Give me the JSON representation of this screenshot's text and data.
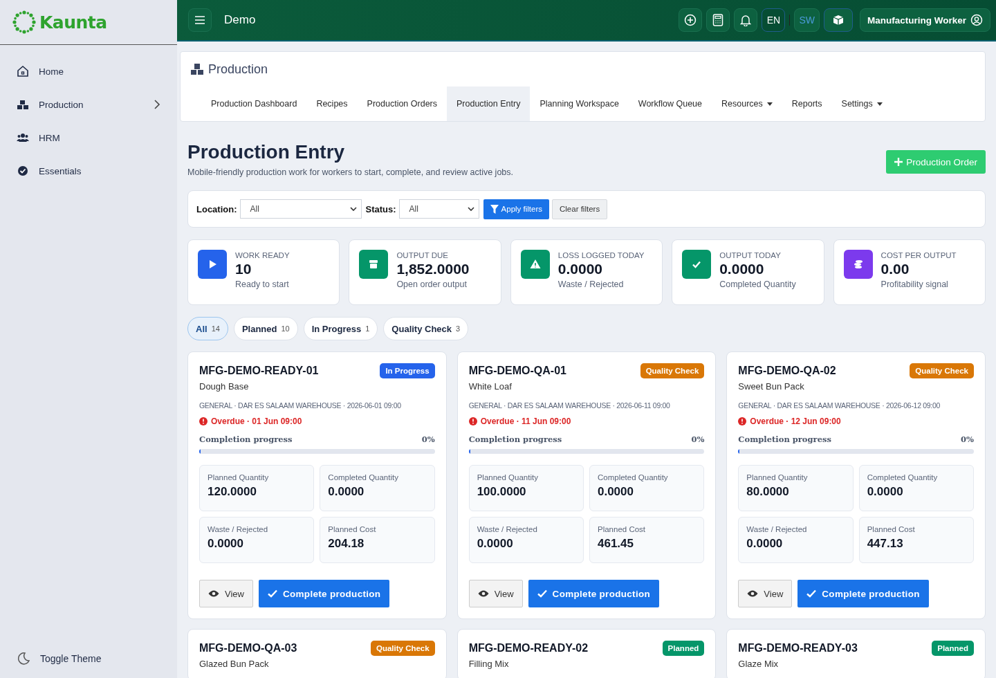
{
  "brand": {
    "name": "Kaunta"
  },
  "sidebar": {
    "items": [
      {
        "label": "Home",
        "expandable": false
      },
      {
        "label": "Production",
        "expandable": true
      },
      {
        "label": "HRM",
        "expandable": false
      },
      {
        "label": "Essentials",
        "expandable": false
      }
    ],
    "footer": {
      "label": "Toggle Theme"
    }
  },
  "topbar": {
    "title": "Demo",
    "languages": [
      {
        "label": "EN",
        "selected": true
      },
      {
        "label": "SW",
        "selected": false
      }
    ],
    "user": "Manufacturing Worker"
  },
  "module": {
    "title": "Production",
    "tabs": [
      {
        "label": "Production Dashboard",
        "selected": false,
        "dropdown": false
      },
      {
        "label": "Recipes",
        "selected": false,
        "dropdown": false
      },
      {
        "label": "Production Orders",
        "selected": false,
        "dropdown": false
      },
      {
        "label": "Production Entry",
        "selected": true,
        "dropdown": false
      },
      {
        "label": "Planning Workspace",
        "selected": false,
        "dropdown": false
      },
      {
        "label": "Workflow Queue",
        "selected": false,
        "dropdown": false
      },
      {
        "label": "Resources",
        "selected": false,
        "dropdown": true
      },
      {
        "label": "Reports",
        "selected": false,
        "dropdown": false
      },
      {
        "label": "Settings",
        "selected": false,
        "dropdown": true
      }
    ]
  },
  "page": {
    "title": "Production Entry",
    "subtitle": "Mobile-friendly production work for workers to start, complete, and review active jobs.",
    "action": "Production Order"
  },
  "filters": {
    "location": {
      "label": "Location:",
      "value": "All"
    },
    "status": {
      "label": "Status:",
      "value": "All"
    },
    "apply": "Apply filters",
    "clear": "Clear filters"
  },
  "metrics": [
    {
      "label": "WORK READY",
      "value": "10",
      "note": "Ready to start",
      "color": "#2563eb"
    },
    {
      "label": "OUTPUT DUE",
      "value": "1,852.0000",
      "note": "Open order output",
      "color": "#059669"
    },
    {
      "label": "LOSS LOGGED TODAY",
      "value": "0.0000",
      "note": "Waste / Rejected",
      "color": "#059669"
    },
    {
      "label": "OUTPUT TODAY",
      "value": "0.0000",
      "note": "Completed Quantity",
      "color": "#059669"
    },
    {
      "label": "COST PER OUTPUT",
      "value": "0.00",
      "note": "Profitability signal",
      "color": "#7c3aed"
    }
  ],
  "status_filters": [
    {
      "label": "All",
      "count": "14",
      "selected": true
    },
    {
      "label": "Planned",
      "count": "10",
      "selected": false
    },
    {
      "label": "In Progress",
      "count": "1",
      "selected": false
    },
    {
      "label": "Quality Check",
      "count": "3",
      "selected": false
    }
  ],
  "orders": [
    {
      "code": "MFG-DEMO-READY-01",
      "status": "In Progress",
      "kind": "in_progress",
      "product": "Dough Base",
      "meta": "GENERAL · DAR ES SALAAM WAREHOUSE · 2026-06-01 09:00",
      "overdue": "Overdue · 01 Jun 09:00",
      "progress_label": "Completion progress",
      "progress_text": "0%",
      "level": 0,
      "stats": [
        {
          "label": "Planned Quantity",
          "value": "120.0000"
        },
        {
          "label": "Completed Quantity",
          "value": "0.0000"
        },
        {
          "label": "Waste / Rejected",
          "value": "0.0000"
        },
        {
          "label": "Planned Cost",
          "value": "204.18"
        }
      ],
      "view": "View",
      "complete": "Complete production"
    },
    {
      "code": "MFG-DEMO-QA-01",
      "status": "Quality Check",
      "kind": "quality_check",
      "product": "White Loaf",
      "meta": "GENERAL · DAR ES SALAAM WAREHOUSE · 2026-06-11 09:00",
      "overdue": "Overdue · 11 Jun 09:00",
      "progress_label": "Completion progress",
      "progress_text": "0%",
      "level": 0,
      "stats": [
        {
          "label": "Planned Quantity",
          "value": "100.0000"
        },
        {
          "label": "Completed Quantity",
          "value": "0.0000"
        },
        {
          "label": "Waste / Rejected",
          "value": "0.0000"
        },
        {
          "label": "Planned Cost",
          "value": "461.45"
        }
      ],
      "view": "View",
      "complete": "Complete production"
    },
    {
      "code": "MFG-DEMO-QA-02",
      "status": "Quality Check",
      "kind": "quality_check",
      "product": "Sweet Bun Pack",
      "meta": "GENERAL · DAR ES SALAAM WAREHOUSE · 2026-06-12 09:00",
      "overdue": "Overdue · 12 Jun 09:00",
      "progress_label": "Completion progress",
      "progress_text": "0%",
      "level": 0,
      "stats": [
        {
          "label": "Planned Quantity",
          "value": "80.0000"
        },
        {
          "label": "Completed Quantity",
          "value": "0.0000"
        },
        {
          "label": "Waste / Rejected",
          "value": "0.0000"
        },
        {
          "label": "Planned Cost",
          "value": "447.13"
        }
      ],
      "view": "View",
      "complete": "Complete production"
    },
    {
      "code": "MFG-DEMO-QA-03",
      "status": "Quality Check",
      "kind": "quality_check",
      "product": "Glazed Bun Pack"
    },
    {
      "code": "MFG-DEMO-READY-02",
      "status": "Planned",
      "kind": "planned",
      "product": "Filling Mix"
    },
    {
      "code": "MFG-DEMO-READY-03",
      "status": "Planned",
      "kind": "planned",
      "product": "Glaze Mix"
    }
  ]
}
